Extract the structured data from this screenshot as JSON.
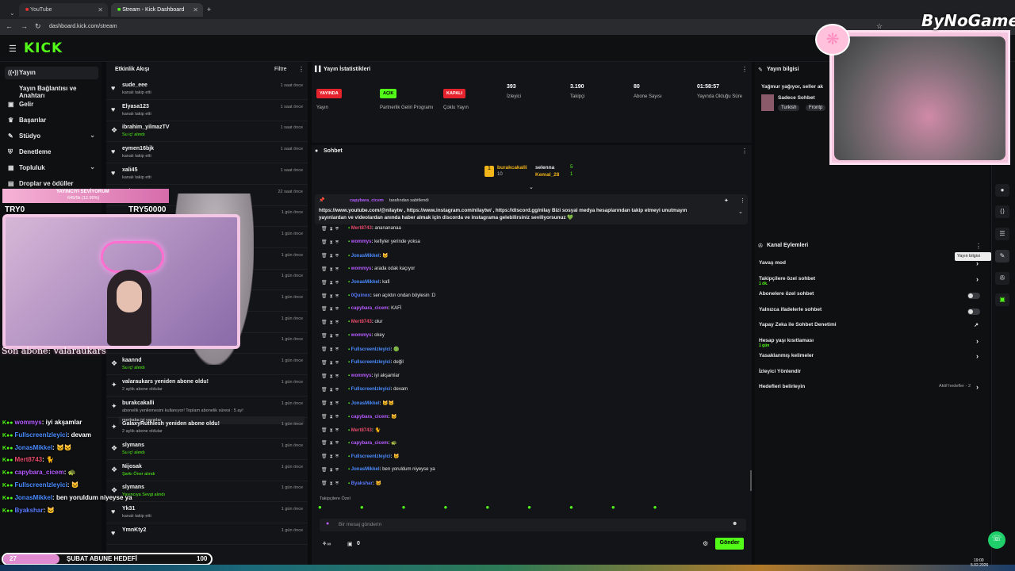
{
  "browser": {
    "tabs": [
      {
        "label": "YouTube"
      },
      {
        "label": "Stream - Kick Dashboard"
      }
    ],
    "url": "dashboard.kick.com/stream"
  },
  "kick": {
    "logo": "KICK"
  },
  "sidebar": {
    "items": [
      {
        "label": "Yayın",
        "icon": "broadcast-icon"
      },
      {
        "label": "Yayın Bağlantısı ve Anahtarı",
        "icon": ""
      },
      {
        "label": "Gelir",
        "icon": "money-icon"
      },
      {
        "label": "Başarılar",
        "icon": "trophy-icon"
      },
      {
        "label": "Stüdyo",
        "icon": "studio-icon"
      },
      {
        "label": "Denetleme",
        "icon": "shield-icon"
      },
      {
        "label": "Topluluk",
        "icon": "community-icon"
      },
      {
        "label": "Droplar ve ödüller",
        "icon": "gift-icon"
      }
    ]
  },
  "feed": {
    "title": "Etkinlik Akışı",
    "filter": "Filtre",
    "items": [
      {
        "name": "sude_eee",
        "sub": "kanalı takip etti",
        "time": "1 saat önce",
        "icon": "♥"
      },
      {
        "name": "Elyasa123",
        "sub": "kanalı takip etti",
        "time": "1 saat önce",
        "icon": "♥"
      },
      {
        "name": "ibrahim_yilmazTV",
        "sub": "Su iç! alındı",
        "time": "1 saat önce",
        "icon": "❖"
      },
      {
        "name": "eymen16bjk",
        "sub": "kanalı takip etti",
        "time": "1 saat önce",
        "icon": "♥"
      },
      {
        "name": "xali45",
        "sub": "kanalı takip etti",
        "time": "1 saat önce",
        "icon": "♥"
      },
      {
        "name": "gok6609",
        "sub": "",
        "time": "22 saat önce",
        "icon": "♥"
      },
      {
        "name": "",
        "sub": "",
        "time": "1 gün önce",
        "icon": ""
      },
      {
        "name": "",
        "sub": "",
        "time": "1 gün önce",
        "icon": ""
      },
      {
        "name": "",
        "sub": "",
        "time": "1 gün önce",
        "icon": ""
      },
      {
        "name": "",
        "sub": "",
        "time": "1 gün önce",
        "icon": ""
      },
      {
        "name": "",
        "sub": "",
        "time": "1 gün önce",
        "icon": ""
      },
      {
        "name": "",
        "sub": "",
        "time": "1 gün önce",
        "icon": ""
      },
      {
        "name": "",
        "sub": "",
        "time": "1 gün önce",
        "icon": ""
      },
      {
        "name": "kaannd",
        "sub": "Su iç! alındı",
        "time": "1 gün önce",
        "icon": "❖"
      },
      {
        "name": "valaraukars yeniden abone oldu!",
        "sub": "2 aylık abone oldular",
        "time": "1 gün önce",
        "icon": "✦"
      },
      {
        "name": "burakcakalli",
        "sub": "abonelik yenilemesini kullanıyor! Toplam abonelik süresi : 5 ay!",
        "time": "1 gün önce",
        "icon": "✦",
        "note": "merhaba iyi yayınlar"
      },
      {
        "name": "GalaxyRuthlesh yeniden abone oldu!",
        "sub": "2 aylık abone oldular",
        "time": "1 gün önce",
        "icon": "✦"
      },
      {
        "name": "slymans",
        "sub": "Su iç! alındı",
        "time": "1 gün önce",
        "icon": "❖"
      },
      {
        "name": "Nijosak",
        "sub": "Şarkı Öner alındı",
        "time": "1 gün önce",
        "icon": "❖"
      },
      {
        "name": "slymans",
        "sub": "Yayıncıya Sevgi alındı",
        "time": "1 gün önce",
        "icon": "❖"
      },
      {
        "name": "Yk31",
        "sub": "kanalı takip etti",
        "time": "1 gün önce",
        "icon": "♥"
      },
      {
        "name": "YmnKty2",
        "sub": "",
        "time": "1 gün önce",
        "icon": "♥"
      }
    ]
  },
  "stats": {
    "title": "Yayın İstatistikleri",
    "cols": [
      {
        "badge": "YAYINDA",
        "badge_color": "#e5232d",
        "label": "Yayın"
      },
      {
        "badge": "AÇIK",
        "badge_color": "#53fc18",
        "label": "Partnerlik Geliri Programı"
      },
      {
        "badge": "KAPALI",
        "badge_color": "#e5232d",
        "label": "Çoklu Yayın"
      },
      {
        "value": "393",
        "label": "İzleyici"
      },
      {
        "value": "3.190",
        "label": "Takipçi"
      },
      {
        "value": "80",
        "label": "Abone Sayısı"
      },
      {
        "value": "01:58:57",
        "label": "Yayında Olduğu Süre"
      }
    ]
  },
  "chat": {
    "title": "Sohbet",
    "leaders": {
      "first": "burakcakalli",
      "first_count": "10",
      "second": "selenna",
      "second_count": "5",
      "third": "Kemal_28",
      "third_count": "1"
    },
    "pinned": {
      "by": "capybara_cicem",
      "by_suffix": "tarafından sabitlendi",
      "text": "https://www.youtube.com/@nilaytw , https://www.instagram.com/nilaytw/ , https://discord.gg/nilay Bizi sosyal medya hesaplarından takip etmeyi unutmayın yayınlardan ve videolardan anında haber almak için discorda ve instagrama gelebilirsiniz seviliyorsunuz 💚"
    },
    "messages": [
      {
        "user": "Mert8743",
        "color": "#e54b6a",
        "text": "ananananaa"
      },
      {
        "user": "wommys",
        "color": "#b65cff",
        "text": "kefiyler yerinde yoksa"
      },
      {
        "user": "JonasMikkel",
        "color": "#4a8cff",
        "text": "🐱"
      },
      {
        "user": "wommys",
        "color": "#b65cff",
        "text": "arada odak kaçıyor"
      },
      {
        "user": "JonasMikkel",
        "color": "#4a8cff",
        "text": "kafi"
      },
      {
        "user": "0Quinox",
        "color": "#5a7bff",
        "text": "sen açıktın ondan böylesin :D"
      },
      {
        "user": "capybara_cicem",
        "color": "#b65cff",
        "text": "KAFİ"
      },
      {
        "user": "Mert8743",
        "color": "#e54b6a",
        "text": "olur"
      },
      {
        "user": "wommys",
        "color": "#b65cff",
        "text": "okey"
      },
      {
        "user": "FullscreenIzleyici",
        "color": "#4a8cff",
        "text": "🟢"
      },
      {
        "user": "FullscreenIzleyici",
        "color": "#4a8cff",
        "text": "değil"
      },
      {
        "user": "wommys",
        "color": "#b65cff",
        "text": "iyi akşamlar"
      },
      {
        "user": "FullscreenIzleyici",
        "color": "#4a8cff",
        "text": "devam"
      },
      {
        "user": "JonasMikkel",
        "color": "#4a8cff",
        "text": "🐱🐱"
      },
      {
        "user": "capybara_cicem",
        "color": "#b65cff",
        "text": "🐱"
      },
      {
        "user": "Mert8743",
        "color": "#e54b6a",
        "text": "🐈"
      },
      {
        "user": "capybara_cicem",
        "color": "#b65cff",
        "text": "🐢"
      },
      {
        "user": "FullscreenIzleyici",
        "color": "#4a8cff",
        "text": "🐱"
      },
      {
        "user": "JonasMikkel",
        "color": "#4a8cff",
        "text": "ben yoruldum niyeyse ya"
      },
      {
        "user": "Byakshar",
        "color": "#5a7bff",
        "text": "🐱"
      }
    ],
    "followers_only": "Takipçilere Özel",
    "input_placeholder": "Bir mesaj gönderin",
    "send": "Gönder",
    "counter": "0"
  },
  "right": {
    "info_title": "Yayın bilgisi",
    "stream_title": "Yağmur yağıyor, seller ak",
    "category": "Sadece Sohbet",
    "tags": [
      "Turkish",
      "Frontp"
    ],
    "actions_title": "Kanal Eylemleri",
    "tooltip": "Yayın bilgisi",
    "actions": [
      {
        "label": "Yavaş mod",
        "sub": "",
        "control": "chevron"
      },
      {
        "label": "Takipçilere özel sohbet",
        "sub": "1 dk.",
        "control": "chevron"
      },
      {
        "label": "Abonelere özel sohbet",
        "sub": "",
        "control": "toggle"
      },
      {
        "label": "Yalnızca ifadelerle sohbet",
        "sub": "",
        "control": "toggle"
      },
      {
        "label": "Yapay Zeka ile Sohbet Denetimi",
        "sub": "",
        "control": "external"
      },
      {
        "label": "Hesap yaşı kısıtlaması",
        "sub": "1 gün",
        "control": "chevron"
      },
      {
        "label": "Yasaklanmış kelimeler",
        "sub": "",
        "control": "chevron"
      },
      {
        "label": "İzleyici Yönlendir",
        "sub": "",
        "control": "none"
      },
      {
        "label": "Hedefleri belirleyin",
        "sub": "",
        "control": "chevron",
        "extra": "Aktif hedefler - 2"
      }
    ]
  },
  "overlay": {
    "brand": "ByNoGame",
    "sub_banner": "YAYINCIYI SEVİYORUM",
    "sub_progress": "645/5k (12.90%)",
    "try_left": "TRY0",
    "try_right": "TRY50000",
    "last_sub": "Son abone: valaraukars",
    "chat": [
      {
        "user": "wommys",
        "color": "#b65cff",
        "text": "iyi akşamlar"
      },
      {
        "user": "FullscreenIzleyici",
        "color": "#4a8cff",
        "text": "devam"
      },
      {
        "user": "JonasMikkel",
        "color": "#4a8cff",
        "text": "🐱🐱"
      },
      {
        "user": "Mert8743",
        "color": "#e54b6a",
        "text": "🐈"
      },
      {
        "user": "capybara_cicem",
        "color": "#b65cff",
        "text": "🐢"
      },
      {
        "user": "FullscreenIzleyici",
        "color": "#4a8cff",
        "text": "🐱"
      },
      {
        "user": "JonasMikkel",
        "color": "#4a8cff",
        "text": "ben yoruldum niyeyse ya"
      },
      {
        "user": "Byakshar",
        "color": "#5a7bff",
        "text": "🐱"
      }
    ],
    "goal": {
      "left": "27",
      "label": "ŞUBAT ABUNE HEDEFİ",
      "right": "100",
      "progress": 0.27
    }
  },
  "taskbar": {
    "time": "19:00",
    "date": "5.02.2026"
  }
}
